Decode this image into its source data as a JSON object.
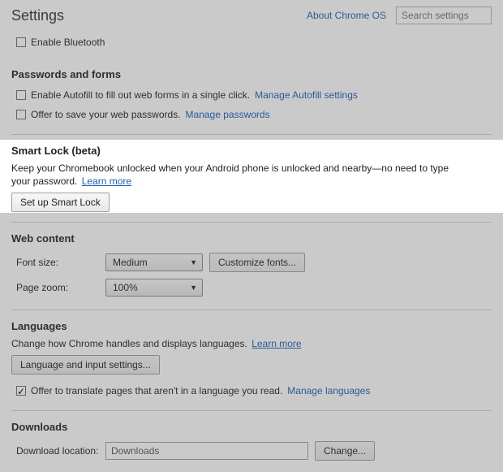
{
  "header": {
    "title": "Settings",
    "about_link": "About Chrome OS",
    "search_placeholder": "Search settings"
  },
  "bluetooth": {
    "enable_label": "Enable Bluetooth"
  },
  "passwords": {
    "title": "Passwords and forms",
    "autofill_label": "Enable Autofill to fill out web forms in a single click.",
    "autofill_link": "Manage Autofill settings",
    "save_pw_label": "Offer to save your web passwords.",
    "save_pw_link": "Manage passwords"
  },
  "smartlock": {
    "title": "Smart Lock (beta)",
    "desc": "Keep your Chromebook unlocked when your Android phone is unlocked and nearby—no need to type your password.",
    "learn_more": "Learn more",
    "button": "Set up Smart Lock"
  },
  "webcontent": {
    "title": "Web content",
    "font_size_label": "Font size:",
    "font_size_value": "Medium",
    "customize_fonts": "Customize fonts...",
    "zoom_label": "Page zoom:",
    "zoom_value": "100%"
  },
  "languages": {
    "title": "Languages",
    "desc": "Change how Chrome handles and displays languages.",
    "learn_more": "Learn more",
    "button": "Language and input settings...",
    "translate_label": "Offer to translate pages that aren't in a language you read.",
    "manage_link": "Manage languages"
  },
  "downloads": {
    "title": "Downloads",
    "location_label": "Download location:",
    "location_value": "Downloads",
    "change_button": "Change..."
  }
}
